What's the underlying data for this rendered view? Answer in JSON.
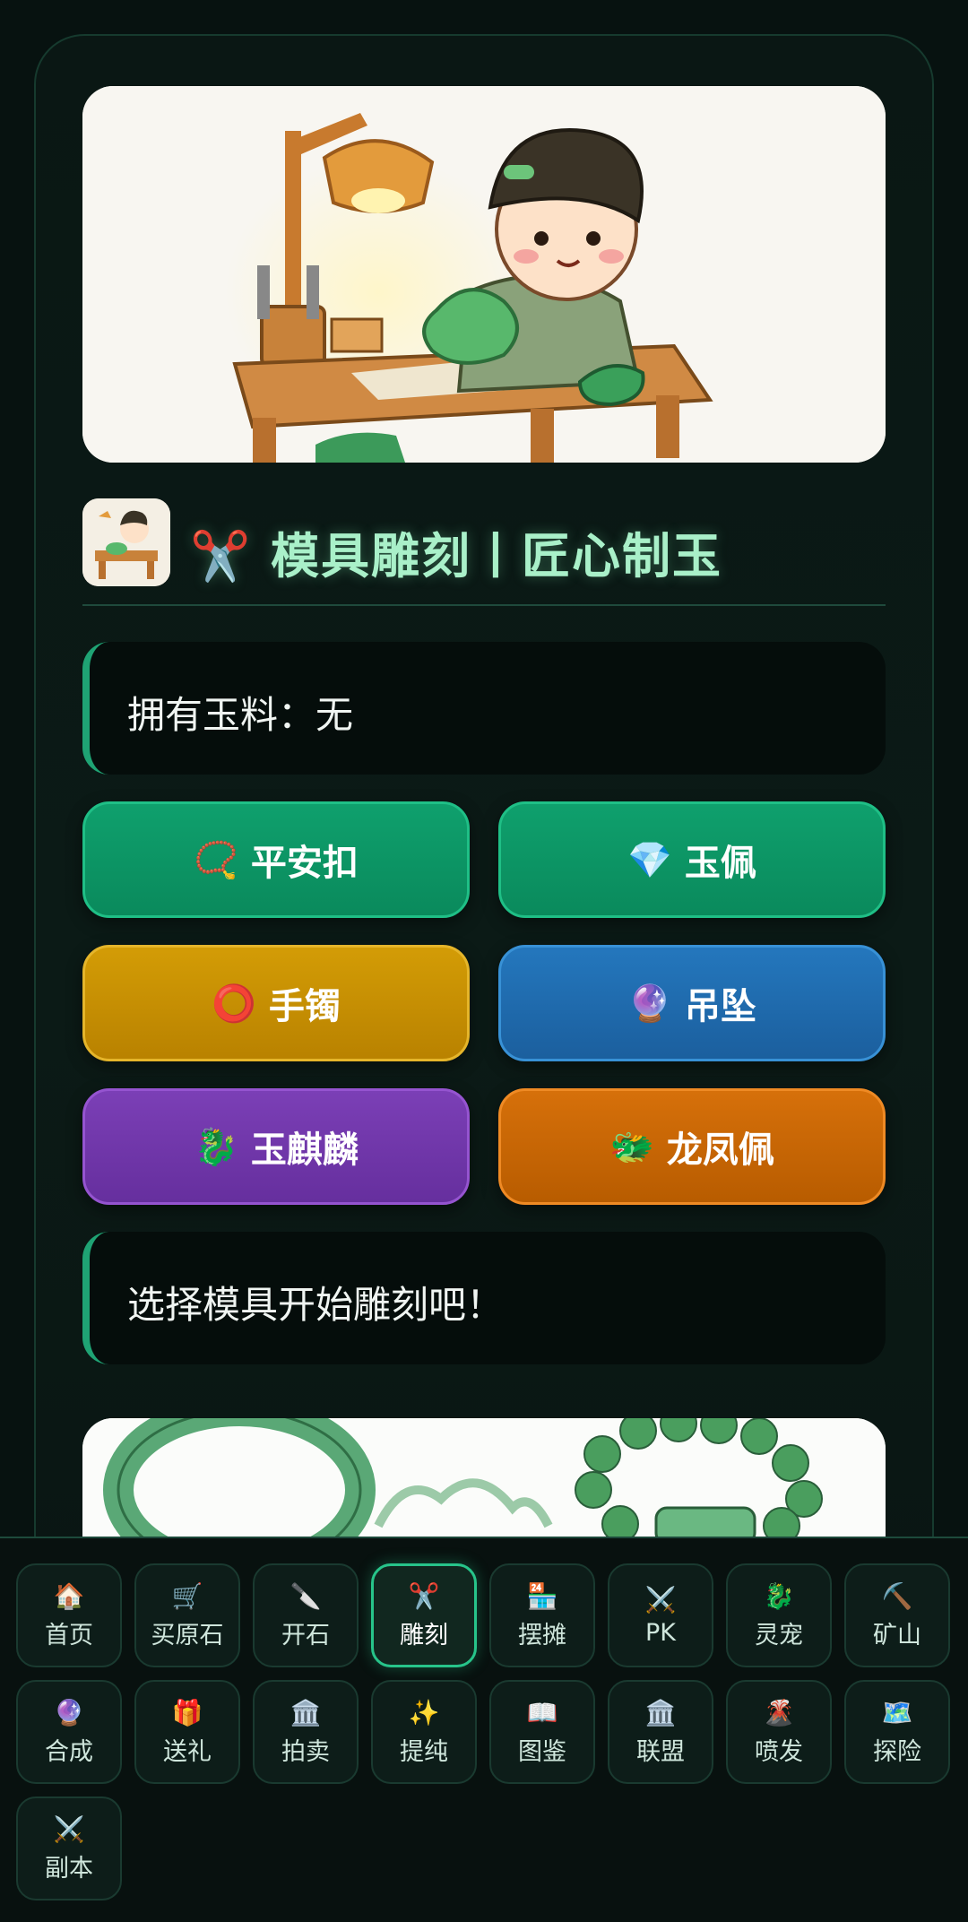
{
  "page": {
    "title": "✂️ 模具雕刻丨匠心制玉",
    "owned_jade": "拥有玉料：无",
    "hint": "选择模具开始雕刻吧！"
  },
  "molds": [
    {
      "icon": "📿",
      "label": "平安扣",
      "color": "green"
    },
    {
      "icon": "💎",
      "label": "玉佩",
      "color": "green"
    },
    {
      "icon": "⭕",
      "label": "手镯",
      "color": "gold"
    },
    {
      "icon": "🔮",
      "label": "吊坠",
      "color": "blue"
    },
    {
      "icon": "🐉",
      "label": "玉麒麟",
      "color": "purple"
    },
    {
      "icon": "🐲",
      "label": "龙凤佩",
      "color": "orange"
    }
  ],
  "nav": [
    {
      "icon": "🏠",
      "label": "首页"
    },
    {
      "icon": "🛒",
      "label": "买原石"
    },
    {
      "icon": "🔪",
      "label": "开石"
    },
    {
      "icon": "✂️",
      "label": "雕刻",
      "active": true
    },
    {
      "icon": "🏪",
      "label": "摆摊"
    },
    {
      "icon": "⚔️",
      "label": "PK"
    },
    {
      "icon": "🐉",
      "label": "灵宠"
    },
    {
      "icon": "⛏️",
      "label": "矿山"
    },
    {
      "icon": "🔮",
      "label": "合成"
    },
    {
      "icon": "🎁",
      "label": "送礼"
    },
    {
      "icon": "🏛️",
      "label": "拍卖"
    },
    {
      "icon": "✨",
      "label": "提纯"
    },
    {
      "icon": "📖",
      "label": "图鉴"
    },
    {
      "icon": "🏛️",
      "label": "联盟"
    },
    {
      "icon": "🌋",
      "label": "喷发"
    },
    {
      "icon": "🗺️",
      "label": "探险"
    },
    {
      "icon": "⚔️",
      "label": "副本"
    }
  ]
}
